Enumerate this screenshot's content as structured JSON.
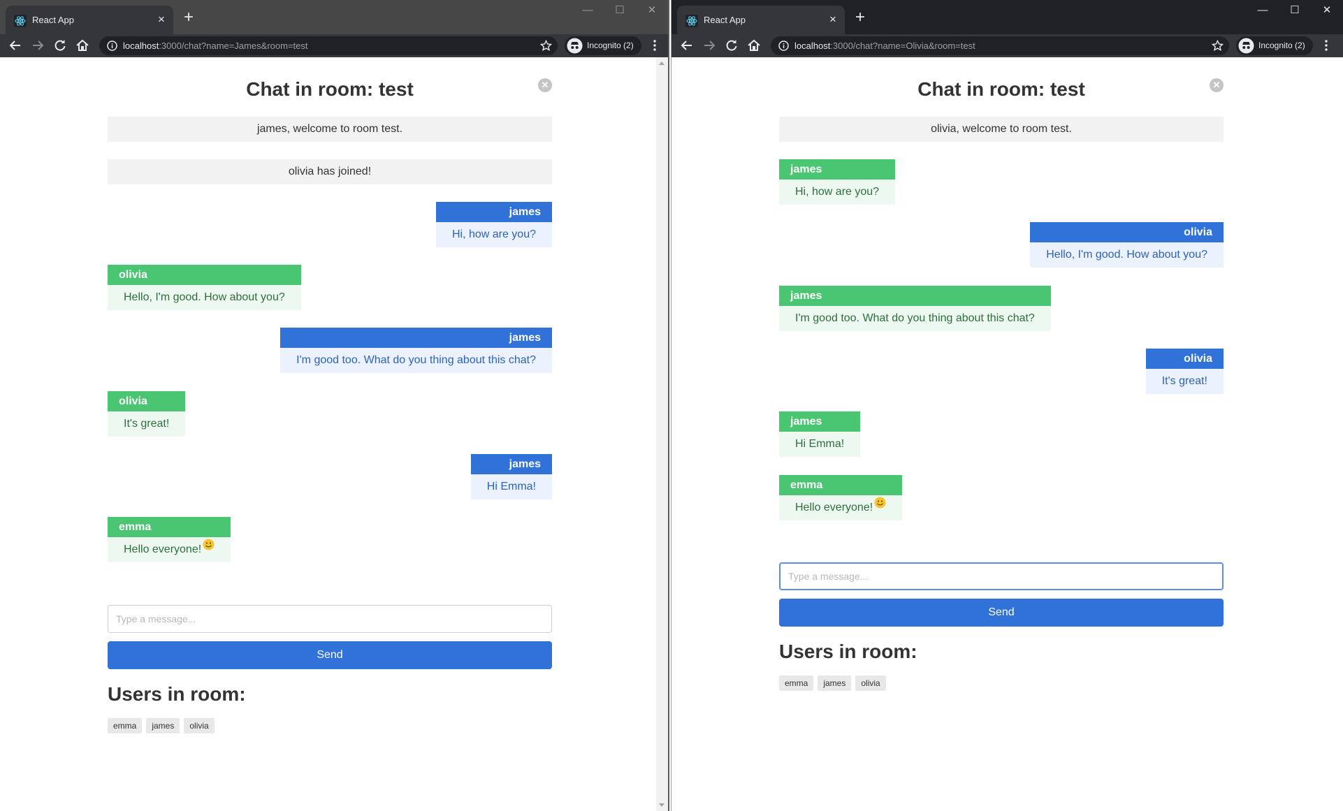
{
  "left_window": {
    "tab_title": "React App",
    "url_host": "localhost",
    "url_path": ":3000/chat?name=James&room=test",
    "incognito_label": "Incognito (2)",
    "page": {
      "title": "Chat in room: test",
      "system_messages": [
        "james, welcome to room test.",
        "olivia has joined!"
      ],
      "messages": [
        {
          "sender": "james",
          "text": "Hi, how are you?",
          "own": true
        },
        {
          "sender": "olivia",
          "text": "Hello, I'm good. How about you?",
          "own": false
        },
        {
          "sender": "james",
          "text": "I'm good too. What do you thing about this chat?",
          "own": true
        },
        {
          "sender": "olivia",
          "text": "It's great!",
          "own": false
        },
        {
          "sender": "james",
          "text": "Hi Emma!",
          "own": true
        },
        {
          "sender": "emma",
          "text": "Hello everyone!",
          "own": false,
          "emoji": "smiley-icon"
        }
      ],
      "input_placeholder": "Type a message...",
      "send_label": "Send",
      "users_title": "Users in room:",
      "users": [
        "emma",
        "james",
        "olivia"
      ]
    }
  },
  "right_window": {
    "tab_title": "React App",
    "url_host": "localhost",
    "url_path": ":3000/chat?name=Olivia&room=test",
    "incognito_label": "Incognito (2)",
    "page": {
      "title": "Chat in room: test",
      "system_messages": [
        "olivia, welcome to room test."
      ],
      "messages": [
        {
          "sender": "james",
          "text": "Hi, how are you?",
          "own": false
        },
        {
          "sender": "olivia",
          "text": "Hello, I'm good. How about you?",
          "own": true
        },
        {
          "sender": "james",
          "text": "I'm good too. What do you thing about this chat?",
          "own": false
        },
        {
          "sender": "olivia",
          "text": "It's great!",
          "own": true
        },
        {
          "sender": "james",
          "text": "Hi Emma!",
          "own": false
        },
        {
          "sender": "emma",
          "text": "Hello everyone!",
          "own": false,
          "emoji": "smiley-icon"
        }
      ],
      "input_placeholder": "Type a message...",
      "send_label": "Send",
      "users_title": "Users in room:",
      "users": [
        "emma",
        "james",
        "olivia"
      ]
    }
  },
  "colors": {
    "own_message_header": "#3072d8",
    "other_message_header": "#4ac571",
    "send_button": "#3072d8"
  }
}
